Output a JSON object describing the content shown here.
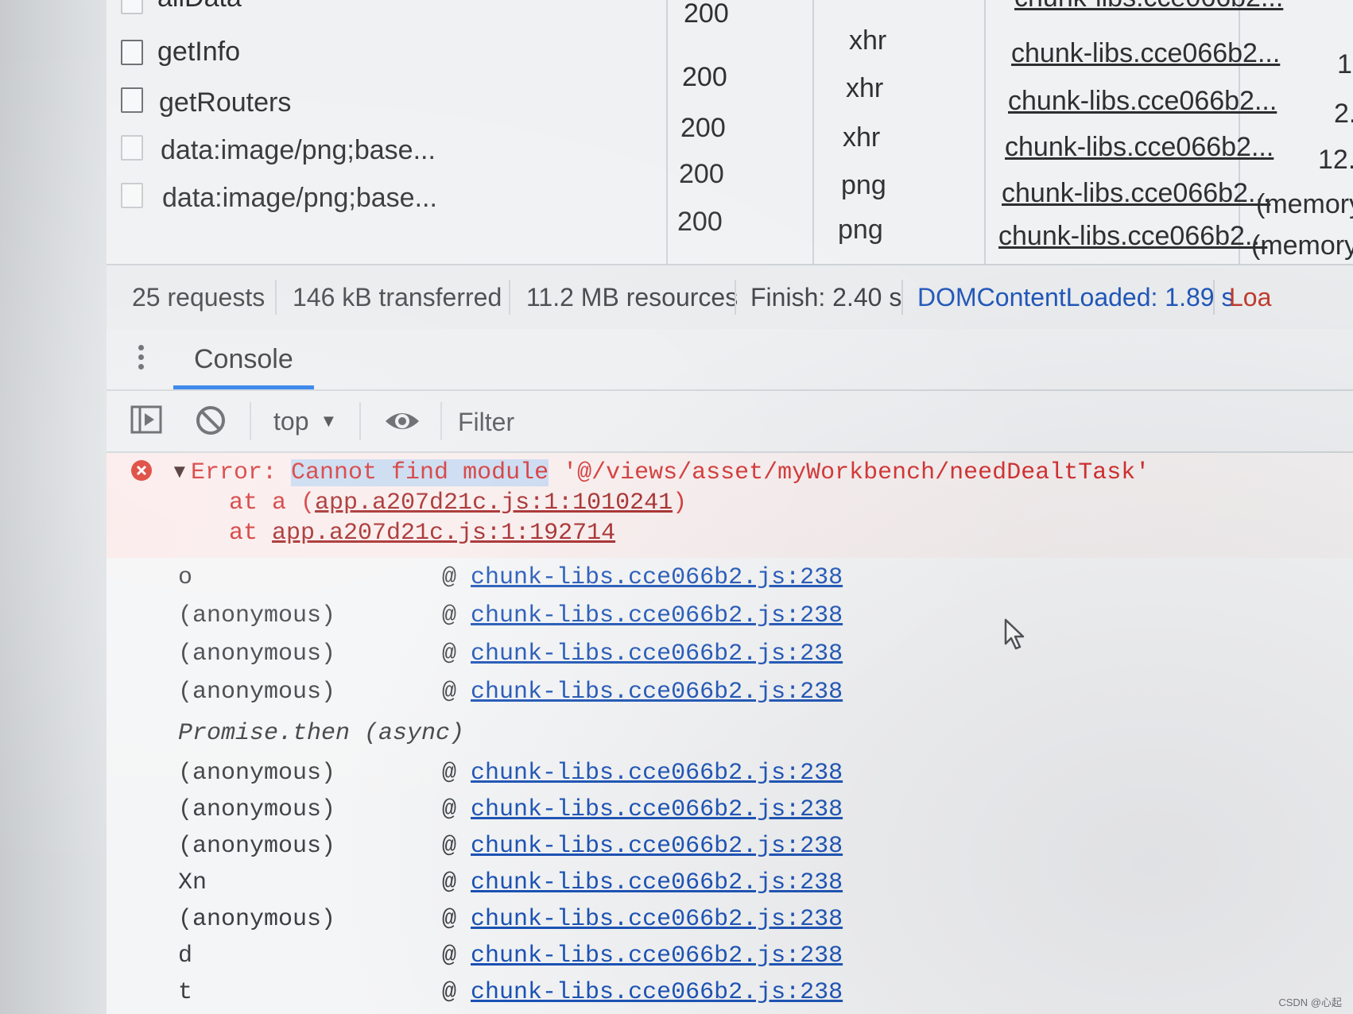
{
  "network": {
    "partial_row_name": "allData",
    "rows": [
      {
        "name": "getInfo",
        "status": "200",
        "type": "xhr",
        "initiator": "chunk-libs.cce066b2...",
        "size": "1"
      },
      {
        "name": "getRouters",
        "status": "200",
        "type": "xhr",
        "initiator": "chunk-libs.cce066b2...",
        "size": "2."
      },
      {
        "name": "data:image/png;base...",
        "status": "200",
        "type": "xhr",
        "initiator": "chunk-libs.cce066b2...",
        "size": "12."
      },
      {
        "name": "data:image/png;base...",
        "status": "200",
        "type": "png",
        "initiator": "chunk-libs.cce066b2...",
        "size": "(memory"
      },
      {
        "name": "",
        "status": "200",
        "type": "png",
        "initiator": "chunk-libs.cce066b2...",
        "size": "(memory"
      }
    ],
    "top_status": "200",
    "top_initiator": "chunk-libs.cce066b2..."
  },
  "summary": {
    "requests": "25 requests",
    "transferred": "146 kB transferred",
    "resources": "11.2 MB resources",
    "finish": "Finish: 2.40 s",
    "dom_content_loaded": "DOMContentLoaded: 1.89 s",
    "load": "Loa"
  },
  "drawer": {
    "tab_console": "Console"
  },
  "toolbar": {
    "context": "top",
    "filter_placeholder": "Filter"
  },
  "console": {
    "error": {
      "prefix": "Error: ",
      "highlighted": "Cannot find module",
      "message": " '@/views/asset/myWorkbench/needDealtTask'",
      "at1_prefix": "at a (",
      "at1_link": "app.a207d21c.js:1:1010241",
      "at1_suffix": ")",
      "at2_prefix": "at ",
      "at2_link": "app.a207d21c.js:1:192714"
    },
    "at_symbol": "@",
    "async_label": "Promise.then (async)",
    "frames": [
      {
        "fn": "o",
        "link": "chunk-libs.cce066b2.js:238"
      },
      {
        "fn": "(anonymous)",
        "link": "chunk-libs.cce066b2.js:238"
      },
      {
        "fn": "(anonymous)",
        "link": "chunk-libs.cce066b2.js:238"
      },
      {
        "fn": "(anonymous)",
        "link": "chunk-libs.cce066b2.js:238"
      },
      {
        "fn": "(anonymous)",
        "link": "chunk-libs.cce066b2.js:238"
      },
      {
        "fn": "(anonymous)",
        "link": "chunk-libs.cce066b2.js:238"
      },
      {
        "fn": "(anonymous)",
        "link": "chunk-libs.cce066b2.js:238"
      },
      {
        "fn": "Xn",
        "link": "chunk-libs.cce066b2.js:238"
      },
      {
        "fn": "(anonymous)",
        "link": "chunk-libs.cce066b2.js:238"
      },
      {
        "fn": "d",
        "link": "chunk-libs.cce066b2.js:238"
      },
      {
        "fn": "t",
        "link": "chunk-libs.cce066b2.js:238"
      }
    ]
  },
  "watermark": "CSDN @心起",
  "colors": {
    "error_red": "#d12a2a",
    "link_blue": "#1750b5",
    "tab_active": "#1a73e8"
  }
}
